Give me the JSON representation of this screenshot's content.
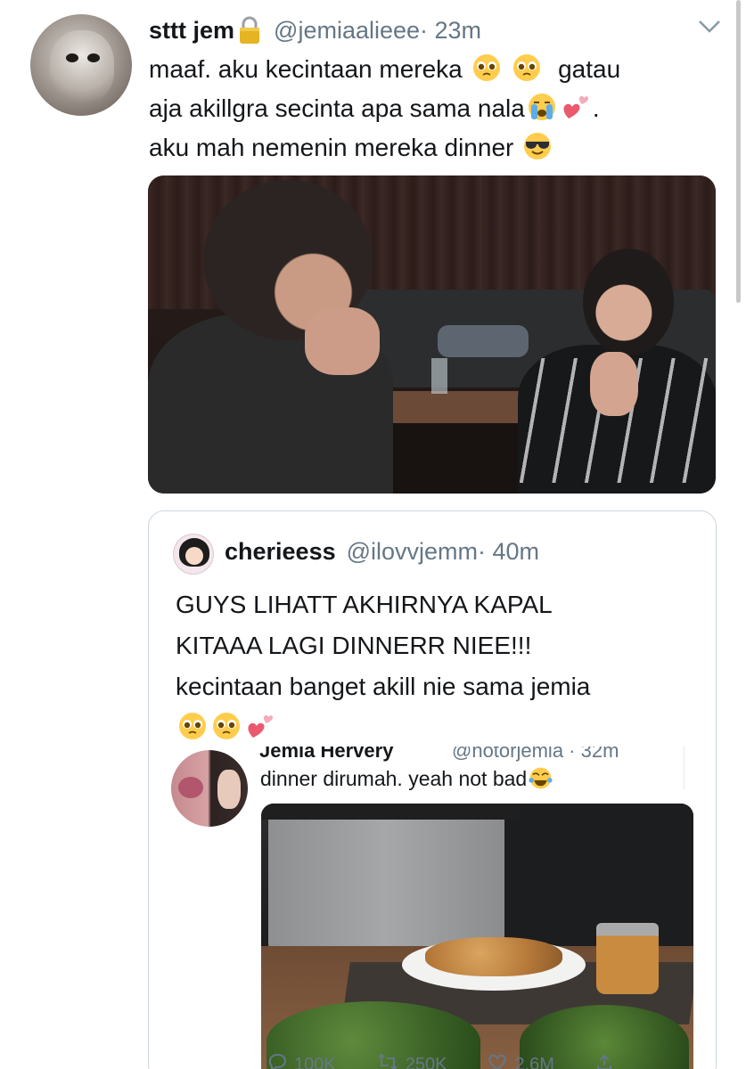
{
  "tweet": {
    "name": "sttt jem",
    "handle": "@jemiaalieee",
    "time": "· 23m",
    "text_line1": "maaf. aku kecintaan mereka",
    "text_line1b": "gatau",
    "text_line2": "aja akillgra secinta apa sama nala",
    "text_line2b": ".",
    "text_line3": "aku mah nemenin mereka dinner"
  },
  "quote": {
    "name": "cherieess",
    "handle": "@ilovvjemm",
    "time": "· 40m",
    "text_line1": "GUYS LIHATT AKHIRNYA KAPAL",
    "text_line2": "KITAAA LAGI DINNERR NIEE!!!",
    "text_line3": "kecintaan banget akill nie sama jemia"
  },
  "nested": {
    "name": "Jemia Hervery",
    "handle": "@notorjemia · 32m",
    "text": "dinner dirumah. yeah not bad"
  },
  "actions": {
    "reply": "100K",
    "retweet": "250K",
    "like": "2.6M"
  },
  "icons": [
    "lock-icon",
    "chevron-down-icon",
    "pleading-face-icon",
    "crying-face-icon",
    "two-hearts-icon",
    "sunglasses-face-icon",
    "tears-of-joy-icon",
    "verified-icon",
    "reply-icon",
    "retweet-icon",
    "like-icon",
    "share-icon"
  ],
  "colors": {
    "text": "#14171a",
    "muted": "#657786",
    "border": "#ccd6dd"
  }
}
